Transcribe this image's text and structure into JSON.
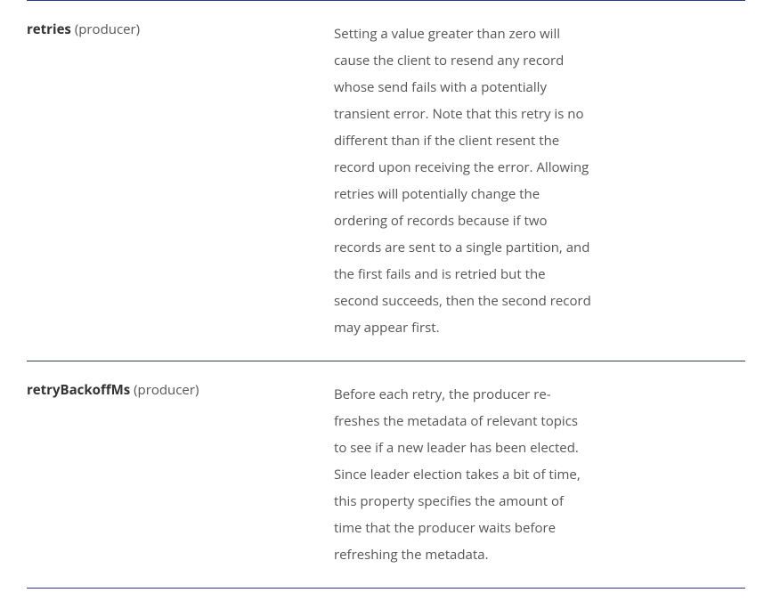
{
  "rows": [
    {
      "name": "retries",
      "context": "(producer)",
      "description": "Setting a value greater than zero will cause the client to resend any record whose send fails with a potentially transient error. Note that this retry is no different than if the client resent the record upon receiving the error. Allowing retries will potentially change the ordering of records because if two records are sent to a single parti­tion, and the first fails and is retried but the second succeeds, then the second record may appear first."
    },
    {
      "name": "retryBackoffMs",
      "context": "(producer)",
      "description": "Before each retry, the producer re­freshes the metadata of relevant top­ics to see if a new leader has been elected. Since leader election takes a bit of time, this property specifies the amount of time that the producer waits before refreshing the metadata."
    }
  ]
}
